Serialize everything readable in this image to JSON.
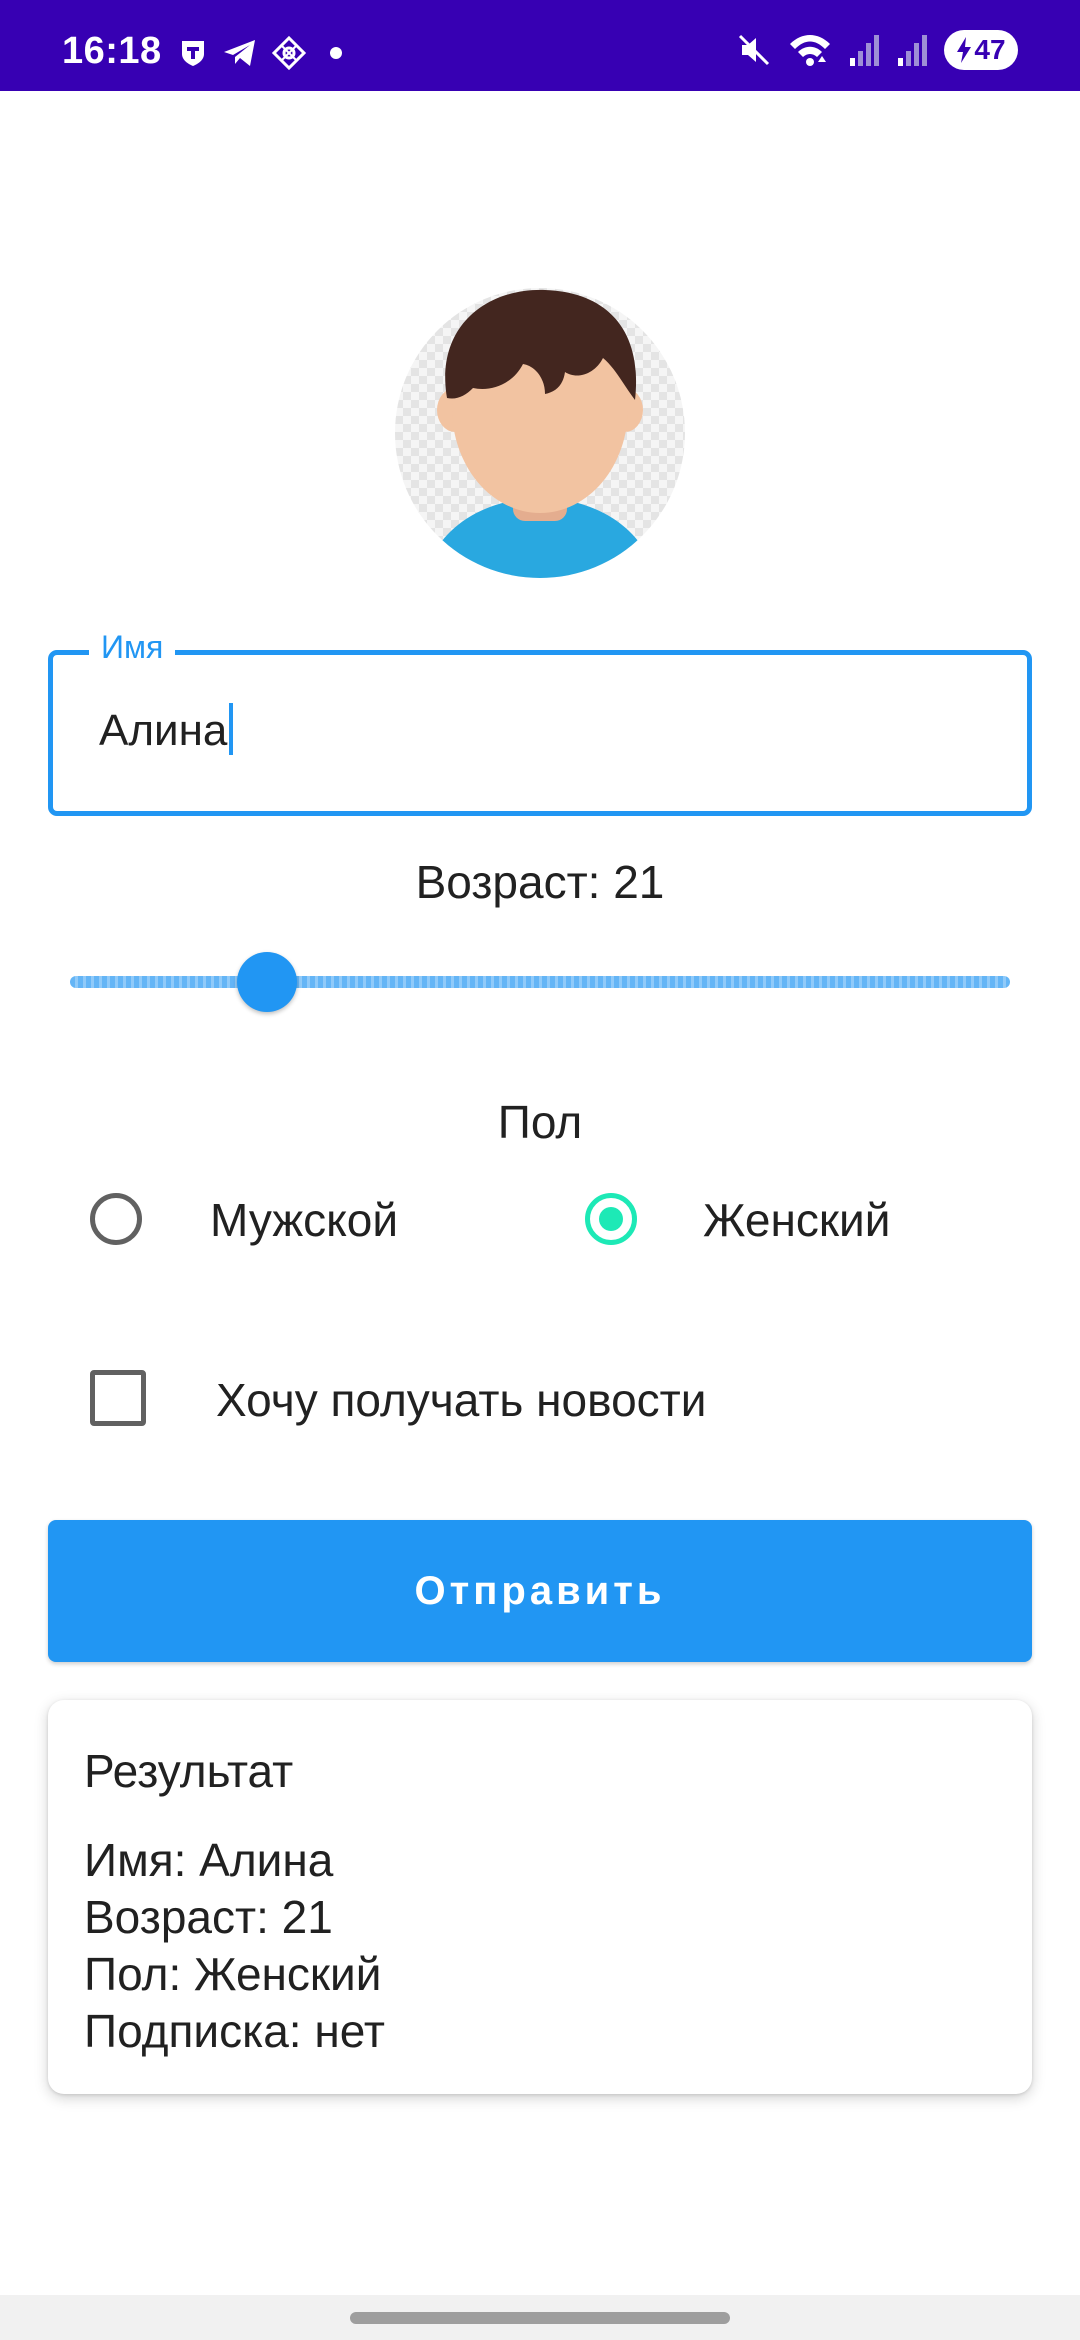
{
  "status_bar": {
    "time": "16:18",
    "battery": "47",
    "left_icons": [
      "shield-notification-icon",
      "telegram-icon",
      "app-notification-icon",
      "dot-icon"
    ],
    "right_icons": [
      "mute-icon",
      "wifi-icon",
      "signal-1-icon",
      "signal-2-icon",
      "battery-charging-icon"
    ],
    "color": "#3700b3"
  },
  "avatar": {
    "icon": "avatar-boy-icon"
  },
  "name_field": {
    "label": "Имя",
    "value": "Алина"
  },
  "age": {
    "text": "Возраст: 21",
    "value": 21,
    "slider_fraction": 0.21
  },
  "gender": {
    "title": "Пол",
    "options": [
      {
        "label": "Мужской",
        "selected": false
      },
      {
        "label": "Женский",
        "selected": true
      }
    ]
  },
  "newsletter": {
    "label": "Хочу получать новости",
    "checked": false
  },
  "submit": {
    "label": "Отправить"
  },
  "result": {
    "title": "Результат",
    "lines": [
      "Имя: Алина",
      "Возраст: 21",
      "Пол: Женский",
      "Подписка: нет"
    ]
  },
  "colors": {
    "accent": "#2196f3",
    "radio_checked": "#1de9b6",
    "status_bar": "#3700b3"
  }
}
